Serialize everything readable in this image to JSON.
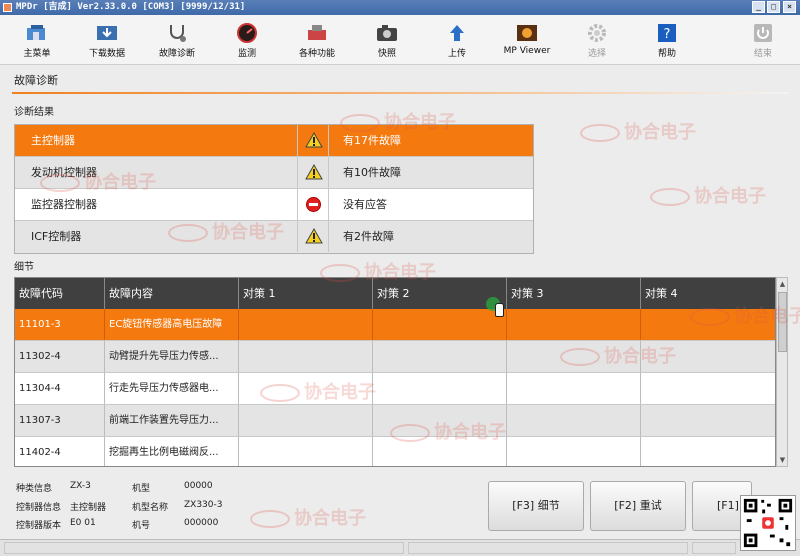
{
  "window": {
    "title": "MPDr [吉成] Ver2.33.0.0 [COM3] [9999/12/31]",
    "controls": [
      "_",
      "□",
      "×"
    ]
  },
  "toolbar": {
    "items": [
      {
        "label": "主菜单",
        "icon": "home-icon"
      },
      {
        "label": "下载数据",
        "icon": "download-data-icon"
      },
      {
        "label": "故障诊断",
        "icon": "stethoscope-icon"
      },
      {
        "label": "监测",
        "icon": "gauge-icon"
      },
      {
        "label": "各种功能",
        "icon": "tools-icon"
      },
      {
        "label": "快照",
        "icon": "camera-icon"
      },
      {
        "label": "上传",
        "icon": "upload-icon"
      },
      {
        "label": "MP Viewer",
        "icon": "viewer-icon"
      },
      {
        "label": "选择",
        "icon": "gear-icon"
      },
      {
        "label": "帮助",
        "icon": "help-icon"
      },
      {
        "label": "结束",
        "icon": "power-icon"
      }
    ]
  },
  "page": {
    "title": "故障诊断",
    "result_heading": "诊断结果",
    "detail_heading": "细节"
  },
  "controllers": [
    {
      "name": "主控制器",
      "status_icon": "warning-icon",
      "status": "有17件故障"
    },
    {
      "name": "发动机控制器",
      "status_icon": "warning-icon",
      "status": "有10件故障"
    },
    {
      "name": "监控器控制器",
      "status_icon": "no-entry-icon",
      "status": "没有应答"
    },
    {
      "name": "ICF控制器",
      "status_icon": "warning-icon",
      "status": "有2件故障"
    }
  ],
  "detail": {
    "columns": [
      "故障代码",
      "故障内容",
      "对策 1",
      "对策 2",
      "对策 3",
      "对策 4"
    ],
    "rows": [
      {
        "code": "11101-3",
        "content": "EC旋钮传感器高电压故障"
      },
      {
        "code": "11302-4",
        "content": "动臂提升先导压力传感..."
      },
      {
        "code": "11304-4",
        "content": "行走先导压力传感器电..."
      },
      {
        "code": "11307-3",
        "content": "前端工作装置先导压力..."
      },
      {
        "code": "11402-4",
        "content": "挖掘再生比例电磁阀反..."
      }
    ]
  },
  "info": {
    "model_category_label": "种类信息",
    "model_category_value": "ZX-3",
    "model_label": "机型",
    "model_value": "00000",
    "controller_info_label": "控制器信息",
    "controller_info_value": "主控制器",
    "model_name_label": "机型名称",
    "model_name_value": "ZX330-3",
    "controller_version_label": "控制器版本",
    "controller_version_value": "E0 01",
    "machine_no_label": "机号",
    "machine_no_value": "000000"
  },
  "buttons": {
    "detail": "[F3] 细节",
    "retry": "[F2] 重试",
    "f1": "[F1]"
  },
  "watermark": "协合电子",
  "colors": {
    "accent": "#f47a10",
    "header_dark": "#404040"
  }
}
